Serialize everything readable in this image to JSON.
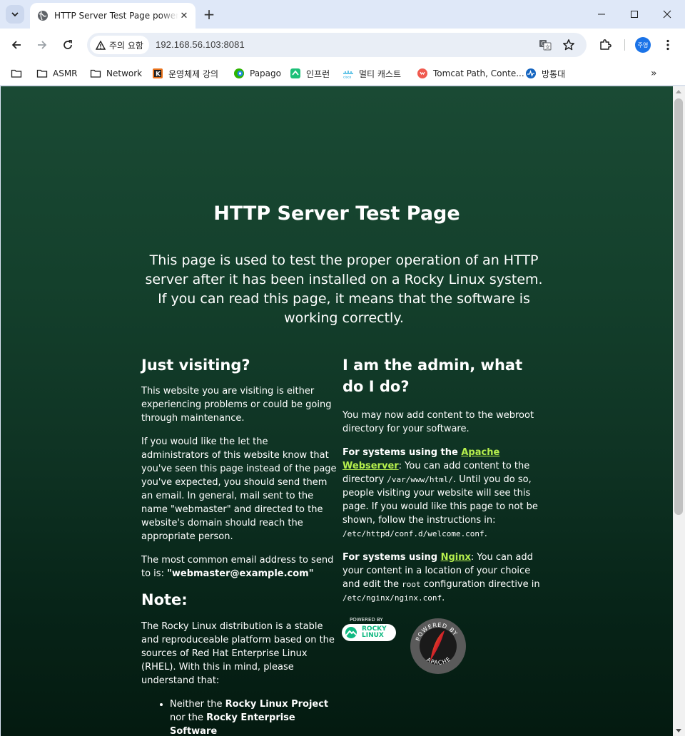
{
  "browser": {
    "tab_title": "HTTP Server Test Page powered by Rocky Linux",
    "security_label": "주의 요함",
    "url": "192.168.56.103:8081",
    "profile_initials": "주영"
  },
  "bookmarks": [
    {
      "label": "",
      "icon": "folder-icon"
    },
    {
      "label": "ASMR",
      "icon": "folder-icon"
    },
    {
      "label": "Network",
      "icon": "folder-icon"
    },
    {
      "label": "운영체제 강의",
      "icon": "k-logo-icon"
    },
    {
      "label": "Papago",
      "icon": "papago-icon"
    },
    {
      "label": "인프런",
      "icon": "inflearn-icon"
    },
    {
      "label": "멀티 캐스트",
      "icon": "cisco-icon"
    },
    {
      "label": "Tomcat Path, Conte...",
      "icon": "tomcat-icon"
    },
    {
      "label": "방통대",
      "icon": "knou-icon"
    }
  ],
  "page": {
    "title": "HTTP Server Test Page",
    "intro": "This page is used to test the proper operation of an HTTP server after it has been installed on a Rocky Linux system. If you can read this page, it means that the software is working correctly.",
    "left": {
      "heading": "Just visiting?",
      "p1": "This website you are visiting is either experiencing problems or could be going through maintenance.",
      "p2": "If you would like the let the administrators of this website know that you've seen this page instead of the page you've expected, you should send them an email. In general, mail sent to the name \"webmaster\" and directed to the website's domain should reach the appropriate person.",
      "p3_prefix": "The most common email address to send to is: ",
      "p3_email": "\"webmaster@example.com\"",
      "note_heading": "Note:",
      "note_p": "The Rocky Linux distribution is a stable and reproduceable platform based on the sources of Red Hat Enterprise Linux (RHEL). With this in mind, please understand that:",
      "li1_a": "Neither the ",
      "li1_b": "Rocky Linux Project",
      "li1_c": " nor the ",
      "li1_d": "Rocky Enterprise Software"
    },
    "right": {
      "heading": "I am the admin, what do I do?",
      "p1": "You may now add content to the webroot directory for your software.",
      "apache_prefix": "For systems using the ",
      "apache_link": "Apache Webserver",
      "apache_text1": ": You can add content to the directory ",
      "apache_dir": "/var/www/html/",
      "apache_text2": ". Until you do so, people visiting your website will see this page. If you would like this page to not be shown, follow the instructions in: ",
      "apache_conf": "/etc/httpd/conf.d/welcome.conf",
      "apache_end": ".",
      "nginx_prefix": "For systems using ",
      "nginx_link": "Nginx",
      "nginx_text1": ": You can add your content in a location of your choice and edit the ",
      "nginx_root": "root",
      "nginx_text2": " configuration directive in ",
      "nginx_conf": "/etc/nginx/nginx.conf",
      "nginx_end": "."
    },
    "logos": {
      "rocky_powered": "POWERED BY",
      "rocky_name_1": "ROCKY",
      "rocky_name_2": "LINUX",
      "apache_powered": "POWERED BY",
      "apache_name": "APACHE"
    }
  },
  "colors": {
    "bg_top": "#1a4a34",
    "bg_bottom": "#041a10",
    "link": "#b6ef4d",
    "rocky_green": "#10b981"
  }
}
